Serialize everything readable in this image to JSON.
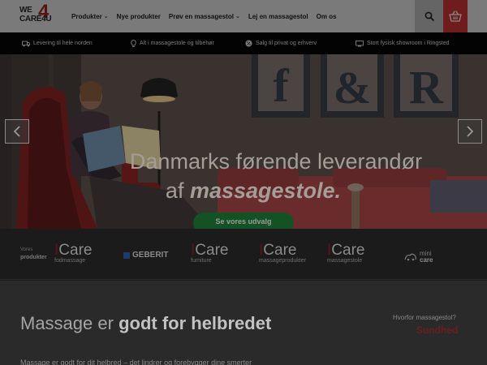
{
  "logo": {
    "line1": "WE",
    "line2": "CARE4U",
    "four": "4"
  },
  "nav": {
    "items": [
      {
        "label": "Produkter",
        "has_dropdown": true
      },
      {
        "label": "Nye produkter",
        "has_dropdown": false
      },
      {
        "label": "Prøv en massagestol",
        "has_dropdown": true
      },
      {
        "label": "Lej en massagestol",
        "has_dropdown": false
      },
      {
        "label": "Om os",
        "has_dropdown": false
      }
    ],
    "search_icon": "search-icon",
    "cart_icon": "basket-icon"
  },
  "usp": [
    {
      "icon": "truck-icon",
      "text": "Levering til hele norden"
    },
    {
      "icon": "lightbulb-icon",
      "text": "Alt i massagestole og tilbehør"
    },
    {
      "icon": "percent-icon",
      "text": "Salg til privat og erhverv"
    },
    {
      "icon": "store-icon",
      "text": "Stort fysisk showroom i Ringsted"
    }
  ],
  "hero": {
    "headline_line1": "Danmarks førende leverandør",
    "headline_line2_prefix": "af ",
    "headline_line2_bold": "massagestole.",
    "cta_label": "Se vores udvalg",
    "arrow_prev": "chevron-left-icon",
    "arrow_next": "chevron-right-icon",
    "wall_letters": [
      "f",
      "&",
      "R"
    ]
  },
  "brands": {
    "label_line1": "Vores",
    "label_line2": "produkter",
    "items": [
      {
        "name": "ICare",
        "sub": "fodmassage"
      },
      {
        "name": "GEBERIT",
        "sub": ""
      },
      {
        "name": "ICare",
        "sub": "furniture"
      },
      {
        "name": "ICare",
        "sub": "massageprodukter"
      },
      {
        "name": "ICare",
        "sub": "massagestole"
      },
      {
        "name_prefix": "mini",
        "name_bold": "care"
      }
    ]
  },
  "content": {
    "title_normal": "Massage er ",
    "title_bold": "godt for helbredet",
    "why_label": "Hvorfor massagestol?",
    "why_answer": "Sundhed",
    "body_text": "Massage er godt for dit helbred – det lindrer og forebygger dine smerter"
  },
  "colors": {
    "overlay_note": "#000000",
    "brand_red": "#b73838",
    "cta_green": "#2b9a4d"
  }
}
